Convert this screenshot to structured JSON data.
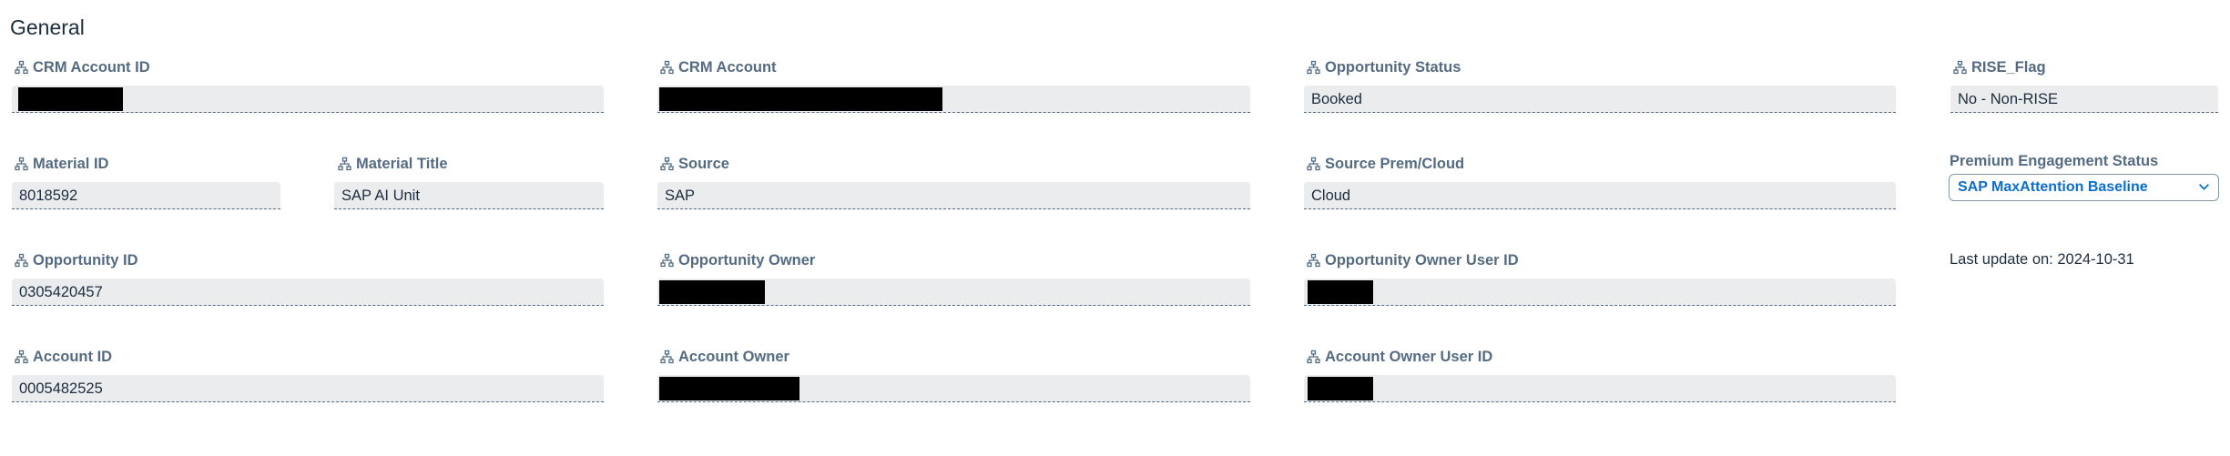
{
  "section": {
    "title": "General"
  },
  "fields": {
    "crm_account_id": {
      "label": "CRM Account ID",
      "value": ""
    },
    "crm_account": {
      "label": "CRM Account",
      "value": ""
    },
    "opportunity_status": {
      "label": "Opportunity Status",
      "value": "Booked"
    },
    "rise_flag": {
      "label": "RISE_Flag",
      "value": "No - Non-RISE"
    },
    "material_id": {
      "label": "Material ID",
      "value": "8018592"
    },
    "material_title": {
      "label": "Material Title",
      "value": "SAP AI Unit"
    },
    "source": {
      "label": "Source",
      "value": "SAP"
    },
    "source_prem_cloud": {
      "label": "Source Prem/Cloud",
      "value": "Cloud"
    },
    "opportunity_id": {
      "label": "Opportunity ID",
      "value": "0305420457"
    },
    "opportunity_owner": {
      "label": "Opportunity Owner",
      "value": ""
    },
    "opportunity_owner_user_id": {
      "label": "Opportunity Owner User ID",
      "value": ""
    },
    "account_id": {
      "label": "Account ID",
      "value": "0005482525"
    },
    "account_owner": {
      "label": "Account Owner",
      "value": ""
    },
    "account_owner_user_id": {
      "label": "Account Owner User ID",
      "value": ""
    }
  },
  "premium_engagement": {
    "label": "Premium Engagement Status",
    "selected": "SAP MaxAttention Baseline"
  },
  "last_update": {
    "text": "Last update on: 2024-10-31"
  },
  "icons": {
    "field_icon": "hierarchy-icon",
    "select_icon": "chevron-down-icon"
  },
  "colors": {
    "label": "#556b82",
    "field_bg": "#eaecee",
    "accent": "#0a6ed1",
    "text": "#1d2d3e"
  }
}
